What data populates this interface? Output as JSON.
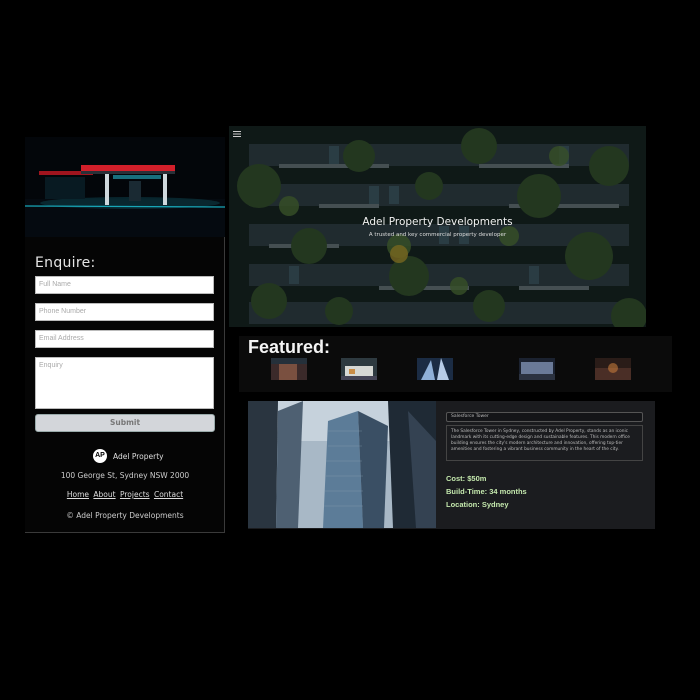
{
  "enquire": {
    "title": "Enquire:",
    "fields": {
      "full_name": "Full Name",
      "phone": "Phone Number",
      "email": "Email Address",
      "enquiry": "Enquiry"
    },
    "submit_label": "Submit"
  },
  "footer": {
    "logo_text": "Adel Property",
    "logo_mark": "AP",
    "address": "100 George St, Sydney NSW 2000",
    "nav": [
      "Home",
      "About",
      "Projects",
      "Contact"
    ],
    "copyright": "© Adel Property Developments"
  },
  "hero": {
    "title": "Adel Property Developments",
    "subtitle": "A trusted and key commercial property developer",
    "menu_icon": "hamburger-icon"
  },
  "featured": {
    "title": "Featured:",
    "thumbnails": [
      "dusk-building",
      "modern-house",
      "glass-tower",
      "night-office",
      "sunset-street"
    ]
  },
  "project": {
    "selected": "Salesforce Tower",
    "description": "The Salesforce Tower in Sydney, constructed by Adel Property, stands as an iconic landmark with its cutting-edge design and sustainable features. This modern office building ensures the city's modern architecture and innovation, offering top-tier amenities and fostering a vibrant business community in the heart of the city.",
    "cost_label": "Cost:",
    "cost_value": "$50m",
    "build_label": "Build-Time:",
    "build_value": "34 months",
    "location_label": "Location:",
    "location_value": "Sydney"
  },
  "colors": {
    "background": "#000000",
    "accent_green": "#c4e8ad",
    "card": "#1b1c1f"
  }
}
